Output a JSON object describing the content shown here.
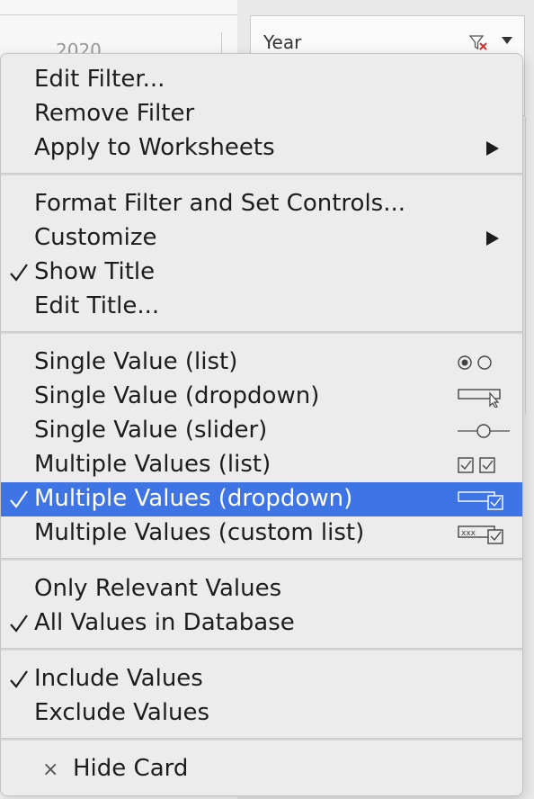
{
  "background": {
    "partial_year": "2020",
    "filter_card_title": "Year"
  },
  "menu": {
    "group1": [
      {
        "label": "Edit Filter...",
        "checked": false,
        "submenu": false
      },
      {
        "label": "Remove Filter",
        "checked": false,
        "submenu": false
      },
      {
        "label": "Apply to Worksheets",
        "checked": false,
        "submenu": true
      }
    ],
    "group2": [
      {
        "label": "Format Filter and Set Controls...",
        "checked": false,
        "submenu": false
      },
      {
        "label": "Customize",
        "checked": false,
        "submenu": true
      },
      {
        "label": "Show Title",
        "checked": true,
        "submenu": false
      },
      {
        "label": "Edit Title...",
        "checked": false,
        "submenu": false
      }
    ],
    "group3": [
      {
        "label": "Single Value (list)",
        "checked": false,
        "icon": "radio-list-icon"
      },
      {
        "label": "Single Value (dropdown)",
        "checked": false,
        "icon": "dropdown-cursor-icon"
      },
      {
        "label": "Single Value (slider)",
        "checked": false,
        "icon": "slider-icon"
      },
      {
        "label": "Multiple Values (list)",
        "checked": false,
        "icon": "checkbox-list-icon"
      },
      {
        "label": "Multiple Values (dropdown)",
        "checked": true,
        "selected": true,
        "icon": "dropdown-checkbox-icon"
      },
      {
        "label": "Multiple Values (custom list)",
        "checked": false,
        "icon": "custom-list-icon"
      }
    ],
    "group4": [
      {
        "label": "Only Relevant Values",
        "checked": false
      },
      {
        "label": "All Values in Database",
        "checked": true
      }
    ],
    "group5": [
      {
        "label": "Include Values",
        "checked": true
      },
      {
        "label": "Exclude Values",
        "checked": false
      }
    ],
    "hide_card": {
      "label": "Hide Card",
      "icon": "close-icon"
    },
    "check_glyph": "✓",
    "submenu_glyph": "▶",
    "close_glyph": "×"
  },
  "colors": {
    "selection": "#3f74e4",
    "menu_background": "#ececec",
    "clear_filter_red": "#d8302f"
  }
}
